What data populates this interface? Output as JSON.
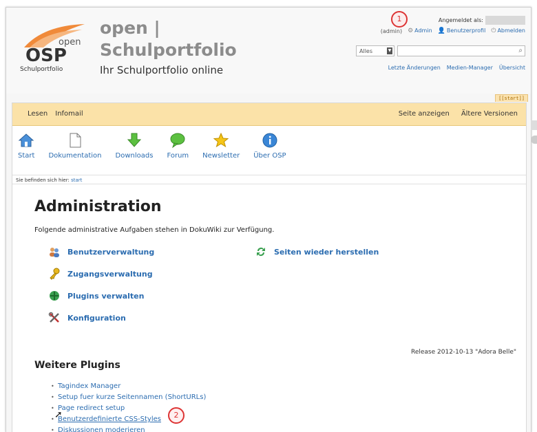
{
  "site": {
    "logo_top": "open",
    "logo_main": "OSP",
    "logo_sub": "Schulportfolio",
    "title_line1": "open |",
    "title_line2": "Schulportfolio",
    "tagline": "Ihr Schulportfolio online"
  },
  "user": {
    "logged_in_label": "Angemeldet als:",
    "role": "(admin)",
    "links": [
      {
        "label": "Admin",
        "icon": "gear-icon"
      },
      {
        "label": "Benutzerprofil",
        "icon": "user-icon"
      },
      {
        "label": "Abmelden",
        "icon": "power-icon"
      }
    ]
  },
  "search": {
    "select_value": "Alles",
    "placeholder": ""
  },
  "tools": [
    "Letzte Änderungen",
    "Medien-Manager",
    "Übersicht"
  ],
  "page_tab": "[[start]]",
  "nav": {
    "left": [
      "Lesen",
      "Infomail"
    ],
    "right": [
      "Seite anzeigen",
      "Ältere Versionen"
    ]
  },
  "iconbar": [
    {
      "label": "Start",
      "icon": "home-icon"
    },
    {
      "label": "Dokumentation",
      "icon": "document-icon"
    },
    {
      "label": "Downloads",
      "icon": "download-arrow-icon"
    },
    {
      "label": "Forum",
      "icon": "speech-bubble-icon"
    },
    {
      "label": "Newsletter",
      "icon": "star-icon"
    },
    {
      "label": "Über OSP",
      "icon": "info-icon"
    }
  ],
  "breadcrumb": {
    "label": "Sie befinden sich hier:",
    "link": "start"
  },
  "admin": {
    "title": "Administration",
    "intro": "Folgende administrative Aufgaben stehen in DokuWiki zur Verfügung.",
    "items": [
      {
        "label": "Benutzerverwaltung",
        "icon": "users-icon"
      },
      {
        "label": "Zugangsverwaltung",
        "icon": "key-icon"
      },
      {
        "label": "Plugins verwalten",
        "icon": "puzzle-icon"
      },
      {
        "label": "Konfiguration",
        "icon": "tools-icon"
      },
      {
        "label": "Seiten wieder herstellen",
        "icon": "recycle-icon"
      }
    ],
    "release": "Release 2012-10-13 \"Adora Belle\""
  },
  "plugins": {
    "title": "Weitere Plugins",
    "items": [
      "Tagindex Manager",
      "Setup fuer kurze Seitennamen (ShortURLs)",
      "Page redirect setup",
      "Benutzerdefinierte CSS-Styles",
      "Diskussionen moderieren"
    ]
  },
  "markers": [
    "1",
    "2"
  ],
  "colors": {
    "nav_bg": "#fbe2a8",
    "link": "#2b6cb0",
    "marker": "#dd3333"
  }
}
